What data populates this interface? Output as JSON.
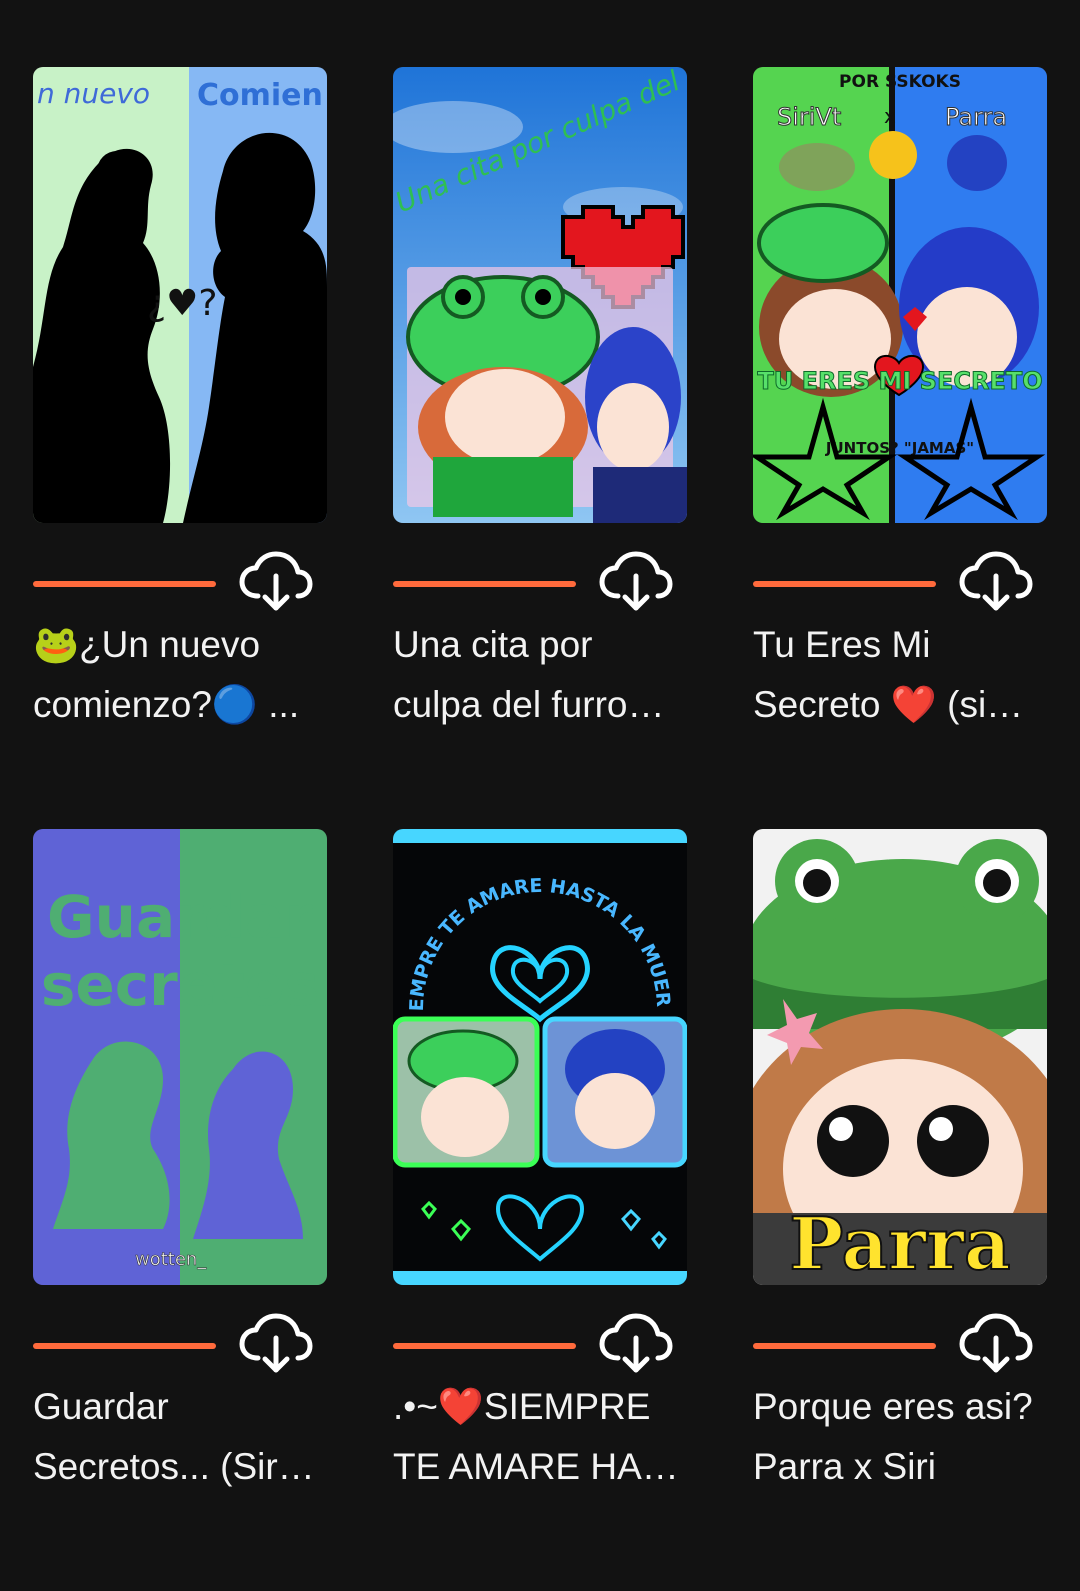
{
  "library": {
    "accent_color": "#ff6a3c",
    "background_color": "#121212",
    "stories": [
      {
        "title": "🐸¿Un nuevo comienzo?🔵 ...",
        "progress": 1.0,
        "cover": {
          "icon": "silhouette-couple-cover",
          "text_left": "n nuevo",
          "text_right": "Comien",
          "text_center": "¿♥?"
        }
      },
      {
        "title": "Una cita por culpa del furro…",
        "progress": 1.0,
        "cover": {
          "icon": "frog-hat-heart-cover",
          "text": "Una cita por culpa del furro"
        }
      },
      {
        "title": "Tu Eres Mi Secreto ❤️ (si…",
        "progress": 1.0,
        "cover": {
          "icon": "split-green-blue-cover",
          "top": "POR SSKOKS",
          "left_name": "SiriVt",
          "x": "x",
          "right_name": "Parra",
          "main": "TU ERES MI SECRETO",
          "sub": "JUNTOS? \"JAMAS\""
        }
      },
      {
        "title": "Guardar Secretos... (Sir…",
        "progress": 1.0,
        "cover": {
          "icon": "split-silhouette-cover",
          "line1": "Guardar",
          "line2": "secretos",
          "signature": "wotten_"
        }
      },
      {
        "title": ".•~❤️SIEMPRE TE AMARE HA…",
        "progress": 1.0,
        "cover": {
          "icon": "neon-heart-cover",
          "arc_text": "SIEMPRE TE AMARE HASTA LA MUERTE"
        }
      },
      {
        "title": "Porque eres asi? Parra x Siri",
        "progress": 1.0,
        "cover": {
          "icon": "frog-hat-closeup-cover",
          "text": "Parra"
        }
      }
    ]
  }
}
